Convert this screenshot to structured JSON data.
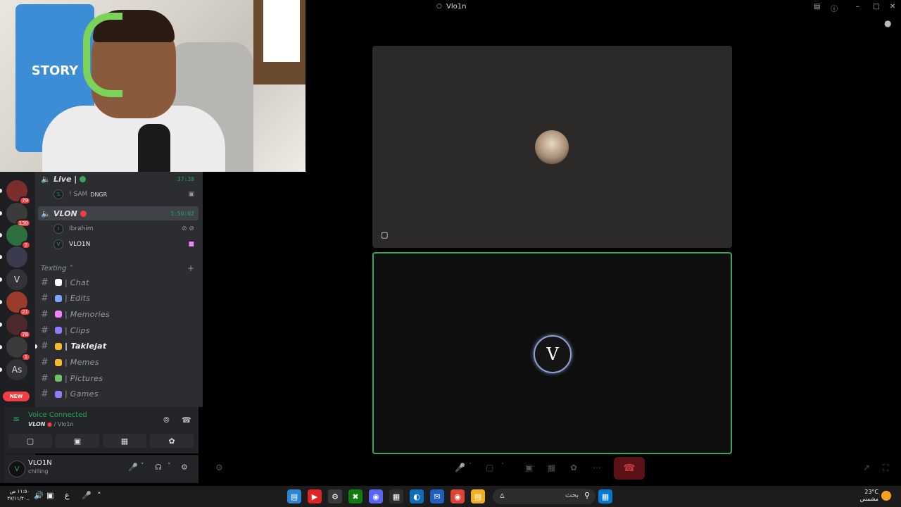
{
  "window": {
    "title": "Vlo1n"
  },
  "voice_channels": [
    {
      "name": "Live |",
      "timer": "37:38",
      "dot_color": "#3ba55d",
      "active": false,
      "users": [
        {
          "name": "! SAM",
          "tag": "DNGR",
          "avatar_letter": "S"
        }
      ]
    },
    {
      "name": "VLON",
      "timer": "1:50:02",
      "dot_color": "#f23f43",
      "active": true,
      "users": [
        {
          "name": "Ibrahim",
          "avatar_letter": "I"
        },
        {
          "name": "VLO1N",
          "avatar_letter": "V"
        }
      ]
    }
  ],
  "category": {
    "name": "Texting"
  },
  "text_channels": [
    {
      "name": "| Chat",
      "emoji_color": "#ffffff",
      "unread": false
    },
    {
      "name": "| Edits",
      "emoji_color": "#7aa6ff",
      "unread": false
    },
    {
      "name": "| Memories",
      "emoji_color": "#f47fff",
      "unread": false
    },
    {
      "name": "| Clips",
      "emoji_color": "#8f7bff",
      "unread": false
    },
    {
      "name": "| Taklejat",
      "emoji_color": "#f7b731",
      "unread": true
    },
    {
      "name": "| Memes",
      "emoji_color": "#f7b731",
      "unread": false
    },
    {
      "name": "| Pictures",
      "emoji_color": "#6cc36a",
      "unread": false
    },
    {
      "name": "| Games",
      "emoji_color": "#8f7bff",
      "unread": false
    }
  ],
  "servers": [
    {
      "label": "",
      "badge": "79",
      "color": "#7a2e2e"
    },
    {
      "label": "",
      "badge": "130",
      "color": "#3b3b3b"
    },
    {
      "label": "",
      "badge": "2",
      "color": "#2f6f3f"
    },
    {
      "label": "",
      "badge": "",
      "color": "#3b3b4f"
    },
    {
      "label": "V",
      "badge": "",
      "color": "#313338"
    },
    {
      "label": "",
      "badge": "21",
      "color": "#9b3b2b"
    },
    {
      "label": "",
      "badge": "78",
      "color": "#4a2a2a"
    },
    {
      "label": "",
      "badge": "1",
      "color": "#3a3a3a"
    },
    {
      "label": "As",
      "badge": "",
      "color": "#313338"
    }
  ],
  "new_pill": "NEW",
  "voice_panel": {
    "status": "Voice Connected",
    "server": "VLON",
    "channel": "/ Vlo1n"
  },
  "user_panel": {
    "username": "VLO1N",
    "status": "chilling",
    "avatar_letter": "V"
  },
  "stage": {
    "bottom_avatar_letter": "V"
  },
  "taskbar": {
    "clock_time": "١١:٥٠ ص",
    "clock_date": "٢٧/١١/٢٠..",
    "lang": "ع",
    "search_label": "بحث",
    "weather_temp": "23°C",
    "weather_text": "مشمس"
  },
  "icons": {
    "speaker": "speaker-icon",
    "camera_off": "camera-off-icon",
    "leave": "leave-call-icon",
    "mic": "microphone-icon",
    "headphones": "headphones-icon",
    "settings": "gear-icon"
  },
  "colors": {
    "connected_green": "#23a559",
    "speaking_border": "#3ba55d",
    "danger": "#f23f43"
  }
}
